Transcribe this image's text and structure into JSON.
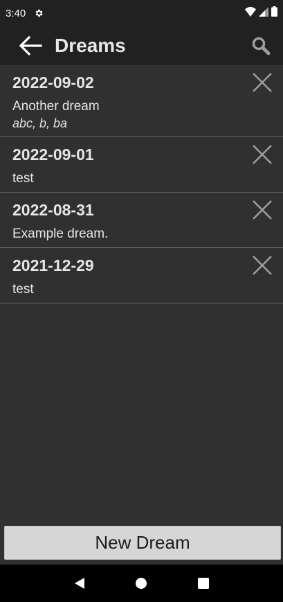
{
  "status_bar": {
    "time": "3:40"
  },
  "app_bar": {
    "title": "Dreams"
  },
  "dreams": [
    {
      "date": "2022-09-02",
      "text": "Another dream",
      "tags": "abc, b, ba"
    },
    {
      "date": "2022-09-01",
      "text": "test",
      "tags": ""
    },
    {
      "date": "2022-08-31",
      "text": "Example dream.",
      "tags": ""
    },
    {
      "date": "2021-12-29",
      "text": "test",
      "tags": ""
    }
  ],
  "actions": {
    "new_dream_label": "New Dream"
  },
  "icons": {
    "back": "arrow-left-icon",
    "search": "search-icon",
    "delete": "close-icon",
    "settings": "gear-icon"
  },
  "colors": {
    "background": "#303030",
    "app_bar": "#212121",
    "button": "#d6d6d6"
  }
}
